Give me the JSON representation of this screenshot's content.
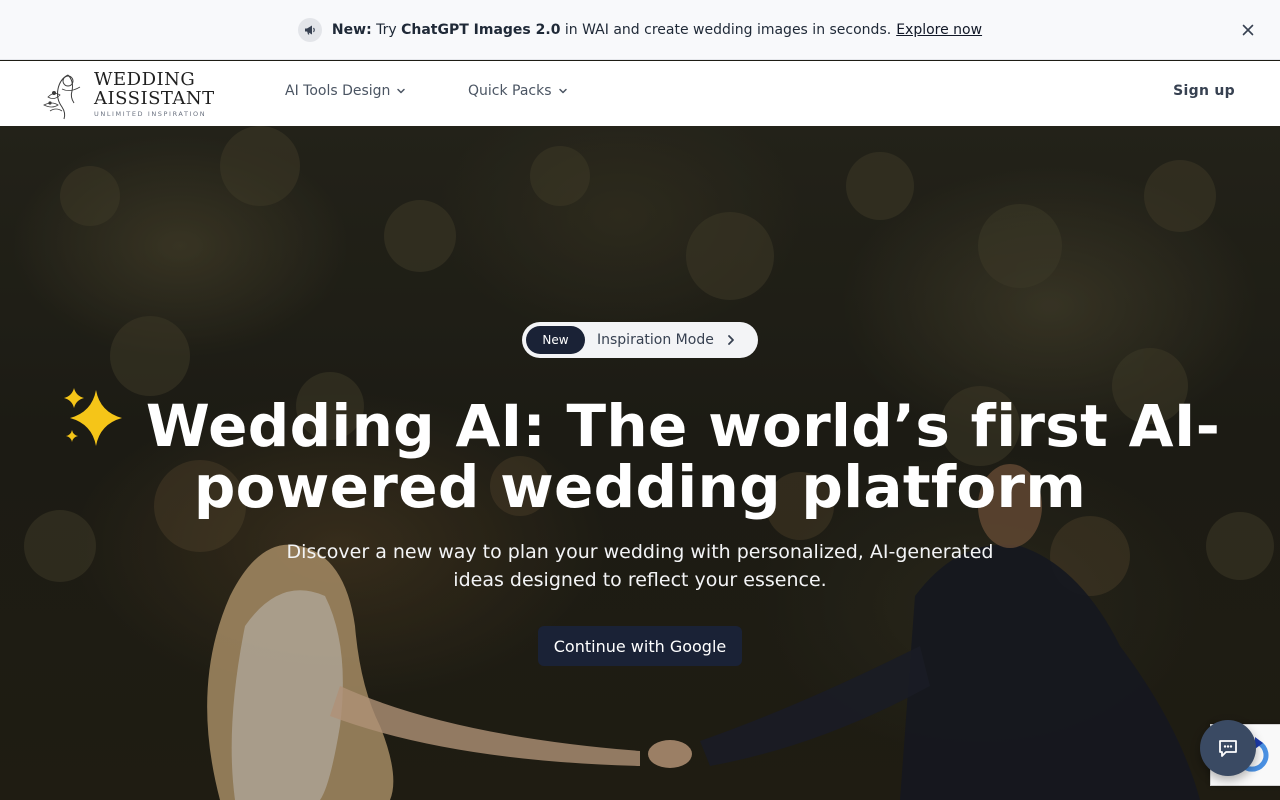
{
  "announcement": {
    "prefix": "New:",
    "text_before": " Try ",
    "highlight": "ChatGPT Images 2.0",
    "text_after": " in WAI and create wedding images in seconds.",
    "link": "Explore now"
  },
  "header": {
    "logo": {
      "line1": "WEDDING",
      "line2": "AISSISTANT",
      "tagline": "UNLIMITED INSPIRATION"
    },
    "nav": [
      {
        "label": "AI Tools Design"
      },
      {
        "label": "Quick Packs"
      }
    ],
    "signup_label": "Sign up"
  },
  "hero": {
    "pill": {
      "badge": "New",
      "label": "Inspiration Mode"
    },
    "headline_line1": "Wedding AI: The world’s first AI-",
    "headline_line2": "powered wedding platform",
    "subtitle_line1": "Discover a new way to plan your wedding with personalized, AI-generated",
    "subtitle_line2": "ideas designed to reflect your essence.",
    "cta_label": "Continue with Google"
  },
  "icons": {
    "announcement": "megaphone-icon",
    "close": "close-icon",
    "dropdown": "chevron-down-icon",
    "pill_arrow": "chevron-right-icon",
    "sparkle": "sparkles-icon",
    "chat": "chat-icon"
  },
  "colors": {
    "announcement_bg": "#f8f9fb",
    "primary_dark": "#1a2236",
    "chat_button": "#3a4a63",
    "headline": "#ffffff"
  }
}
